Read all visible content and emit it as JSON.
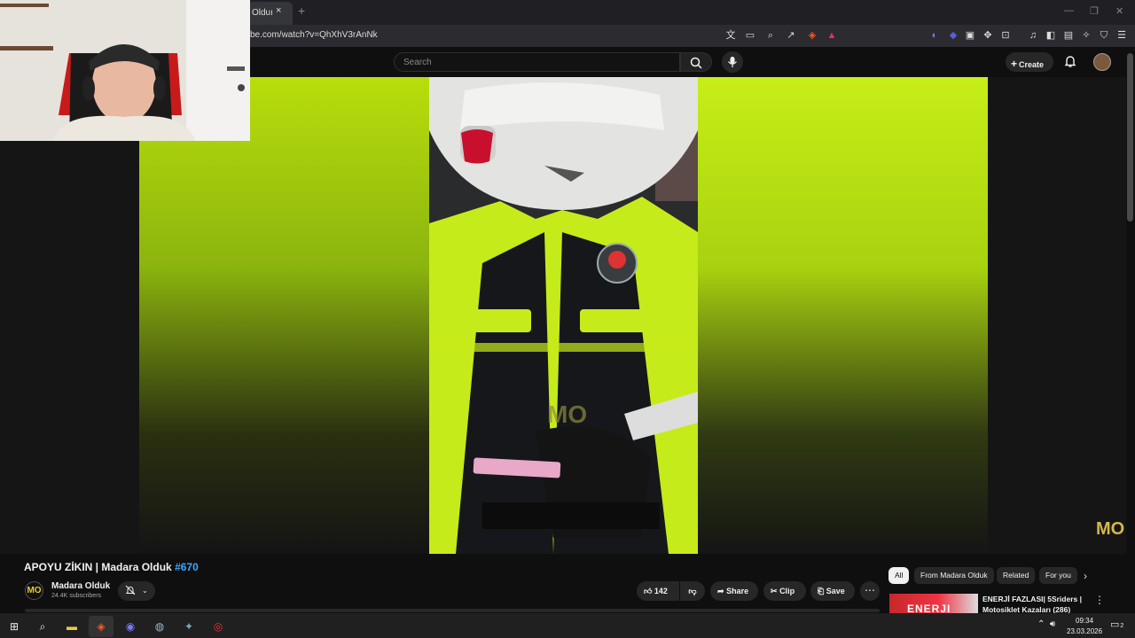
{
  "browser": {
    "tab_title": "Olduı",
    "tab_close": "×",
    "new_tab": "+",
    "url": "be.com/watch?v=QhXhV3rAnNk",
    "window_min": "—",
    "window_restore": "❐",
    "window_close": "✕"
  },
  "masthead": {
    "search_placeholder": "Search",
    "create_label": "Create"
  },
  "video": {
    "watermark": "MO",
    "title": "APOYU ZİKIN | Madara Olduk ",
    "title_tag": "#670"
  },
  "channel": {
    "avatar_text": "MO",
    "name": "Madara Olduk",
    "subscribers": "24.4K subscribers"
  },
  "actions": {
    "like_count": "142",
    "share_label": "Share",
    "clip_label": "Clip",
    "save_label": "Save"
  },
  "chips": [
    "All",
    "From Madara Olduk",
    "Related",
    "For you"
  ],
  "recommendation": {
    "thumb_text": "ENERJI",
    "title": "ENERJİ FAZLASI| 5Sriders | Motosiklet Kazaları (286)"
  },
  "taskbar": {
    "time": "09:34",
    "date": "23.03.2026",
    "notifications": "2"
  },
  "colors": {
    "accent_link": "#3ea6ff",
    "background": "#0f0f0f",
    "chip_selected": "#f1f1f1"
  }
}
